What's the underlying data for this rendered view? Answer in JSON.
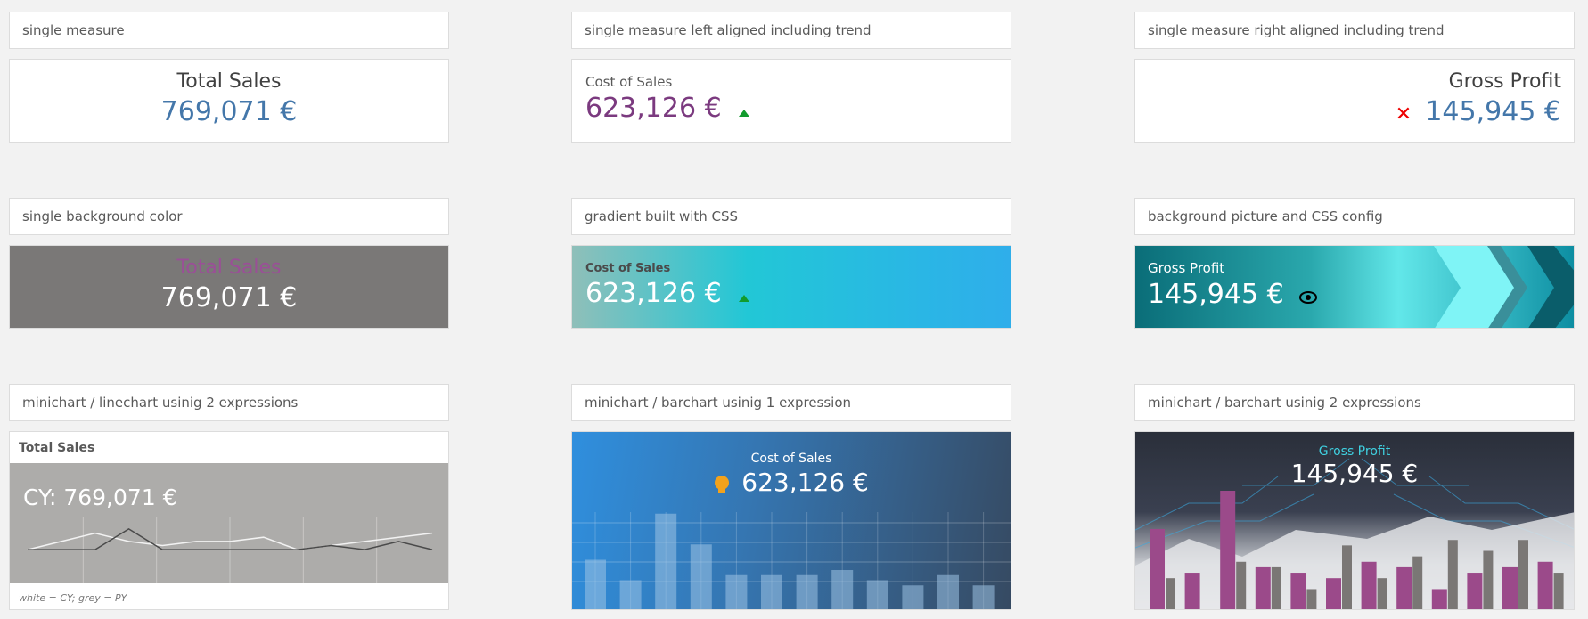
{
  "headers": {
    "r1c1": "single measure",
    "r1c2": "single measure left aligned including trend",
    "r1c3": "single measure right aligned including trend",
    "r2c1": "single background color",
    "r2c2": "gradient built with CSS",
    "r2c3": "background picture and CSS config",
    "r3c1": "minichart / linechart usinig 2 expressions",
    "r3c2": "minichart / barchart usinig 1 expression",
    "r3c3": "minichart / barchart usinig 2 expressions"
  },
  "kpis": {
    "total_sales_label": "Total Sales",
    "total_sales_value": "769,071 €",
    "cost_label": "Cost of Sales",
    "cost_value": "623,126 €",
    "gross_label": "Gross Profit",
    "gross_value": "145,945 €"
  },
  "linechart": {
    "label": "Total Sales",
    "value": "CY: 769,071 €",
    "footnote": "white = CY; grey = PY"
  },
  "colors": {
    "accent_blue": "#4477aa",
    "purple": "#7b3a7f",
    "trend_up": "#129b2d",
    "trend_bad": "#e00000",
    "bar_purple": "#9b4a8a",
    "bar_grey": "#7a7775"
  },
  "icons": [
    "triangle-up-icon",
    "x-mark-icon",
    "eye-icon",
    "lightbulb-icon"
  ],
  "chart_data": [
    {
      "type": "line",
      "series": [
        {
          "name": "CY",
          "values": [
            3,
            4,
            5,
            4,
            3.5,
            4,
            4,
            4.5,
            3,
            3.5,
            4,
            4.5,
            5
          ]
        },
        {
          "name": "PY",
          "values": [
            3,
            3,
            3,
            5.5,
            3,
            3,
            3,
            3,
            3,
            3.5,
            3,
            4,
            3
          ]
        }
      ]
    },
    {
      "type": "bar",
      "values": [
        5,
        3,
        9.5,
        6.5,
        3.5,
        3.5,
        3.5,
        4,
        3,
        2.5,
        3.5,
        2.5
      ]
    },
    {
      "type": "bar",
      "series": [
        {
          "values": [
            7.5,
            3.5,
            11,
            4,
            3.5,
            3,
            4.5,
            4,
            2,
            3.5,
            4,
            4.5
          ]
        },
        {
          "values": [
            3,
            0,
            4.5,
            4,
            2,
            6,
            3,
            5,
            6.5,
            5.5,
            6.5,
            3.5
          ]
        }
      ]
    }
  ]
}
